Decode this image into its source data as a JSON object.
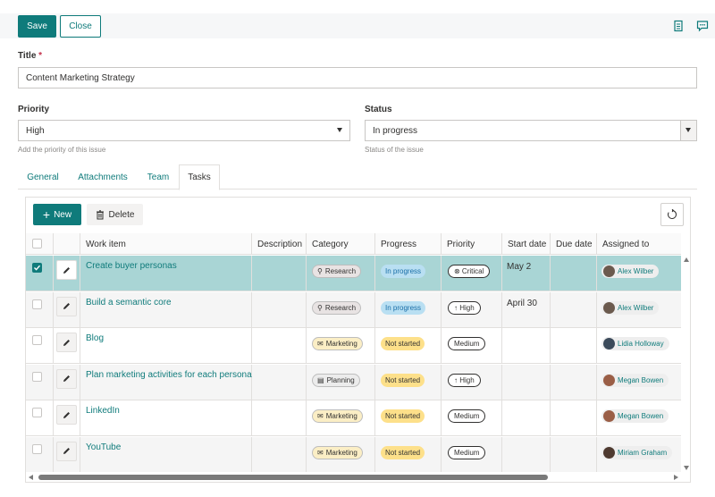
{
  "toolbar": {
    "save_label": "Save",
    "close_label": "Close",
    "icons": [
      "document-icon",
      "comment-icon"
    ]
  },
  "form": {
    "title_label": "Title",
    "required_mark": "*",
    "title_value": "Content Marketing Strategy",
    "priority_label": "Priority",
    "priority_value": "High",
    "priority_help": "Add the priority of this issue",
    "status_label": "Status",
    "status_value": "In progress",
    "status_help": "Status of the issue"
  },
  "tabs": [
    "General",
    "Attachments",
    "Team",
    "Tasks"
  ],
  "active_tab": "Tasks",
  "grid": {
    "new_label": "New",
    "delete_label": "Delete",
    "columns": [
      "Work item",
      "Description",
      "Category",
      "Progress",
      "Priority",
      "Start date",
      "Due date",
      "Assigned to"
    ],
    "rows": [
      {
        "work": "Create buyer personas",
        "category": "Research",
        "progress": "In progress",
        "priority": "Critical",
        "start": "May 2",
        "assigned": "Alex Wilber",
        "selected": true
      },
      {
        "work": "Build a semantic core",
        "category": "Research",
        "progress": "In progress",
        "priority": "High",
        "start": "April 30",
        "assigned": "Alex Wilber",
        "selected": false
      },
      {
        "work": "Blog",
        "category": "Marketing",
        "progress": "Not started",
        "priority": "Medium",
        "start": "",
        "assigned": "Lidia Holloway",
        "selected": false
      },
      {
        "work": "Plan marketing activities for each persona",
        "category": "Planning",
        "progress": "Not started",
        "priority": "High",
        "start": "",
        "assigned": "Megan Bowen",
        "selected": false
      },
      {
        "work": "LinkedIn",
        "category": "Marketing",
        "progress": "Not started",
        "priority": "Medium",
        "start": "",
        "assigned": "Megan Bowen",
        "selected": false
      },
      {
        "work": "YouTube",
        "category": "Marketing",
        "progress": "Not started",
        "priority": "Medium",
        "start": "",
        "assigned": "Miriam Graham",
        "selected": false
      }
    ]
  },
  "colors": {
    "accent": "#0f7b7b",
    "selected_row": "#a9d5d5",
    "in_progress_bg": "#b9dff2",
    "in_progress_fg": "#1a6fa8",
    "not_started_bg": "#fde08a",
    "research_bg": "#e8e3e3",
    "marketing_bg": "#fbeec5",
    "planning_bg": "#ececec"
  }
}
